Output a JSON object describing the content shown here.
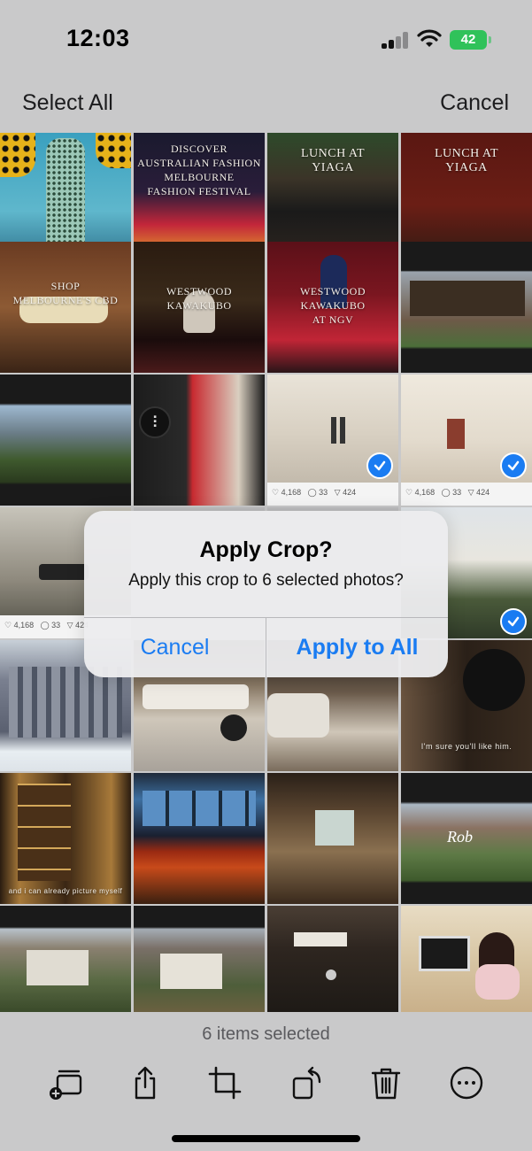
{
  "status_bar": {
    "time": "12:03",
    "battery": "42"
  },
  "nav": {
    "select_all": "Select All",
    "cancel": "Cancel"
  },
  "tiles": [
    {
      "label": ""
    },
    {
      "label": "DISCOVER AUSTRALIAN FASHION\nMELBOURNE\nFASHION FESTIVAL"
    },
    {
      "label": "LUNCH AT\nYIAGA"
    },
    {
      "label": "LUNCH AT\nYIAGA"
    },
    {
      "label": "SHOP\nMELBOURNE'S CBD"
    },
    {
      "label": "WESTWOOD KAWAKUBO"
    },
    {
      "label": "WESTWOOD KAWAKUBO\nAT NGV"
    },
    {
      "label": ""
    },
    {
      "label": ""
    },
    {
      "label": ""
    },
    {
      "label": ""
    },
    {
      "label": ""
    },
    {
      "label": ""
    },
    {
      "label": ""
    },
    {
      "label": ""
    },
    {
      "label": ""
    },
    {
      "label": ""
    },
    {
      "label": ""
    },
    {
      "label": ""
    },
    {
      "label": "I'm sure you'll like him."
    },
    {
      "label": "and i can already picture myself"
    },
    {
      "label": ""
    },
    {
      "label": ""
    },
    {
      "label": ""
    },
    {
      "label": ""
    },
    {
      "label": ""
    },
    {
      "label": ""
    },
    {
      "label": ""
    }
  ],
  "dialog": {
    "title": "Apply Crop?",
    "message": "Apply this crop to 6 selected photos?",
    "cancel": "Cancel",
    "apply": "Apply to All"
  },
  "toolbar": {
    "selected_count": "6 items selected",
    "icons": [
      "add-to-album-icon",
      "share-icon",
      "crop-icon",
      "rotate-icon",
      "trash-icon",
      "more-icon"
    ]
  },
  "colors": {
    "accent": "#1a7cf2",
    "battery": "#30c25a",
    "bar_bg": "#c9c9ca"
  }
}
